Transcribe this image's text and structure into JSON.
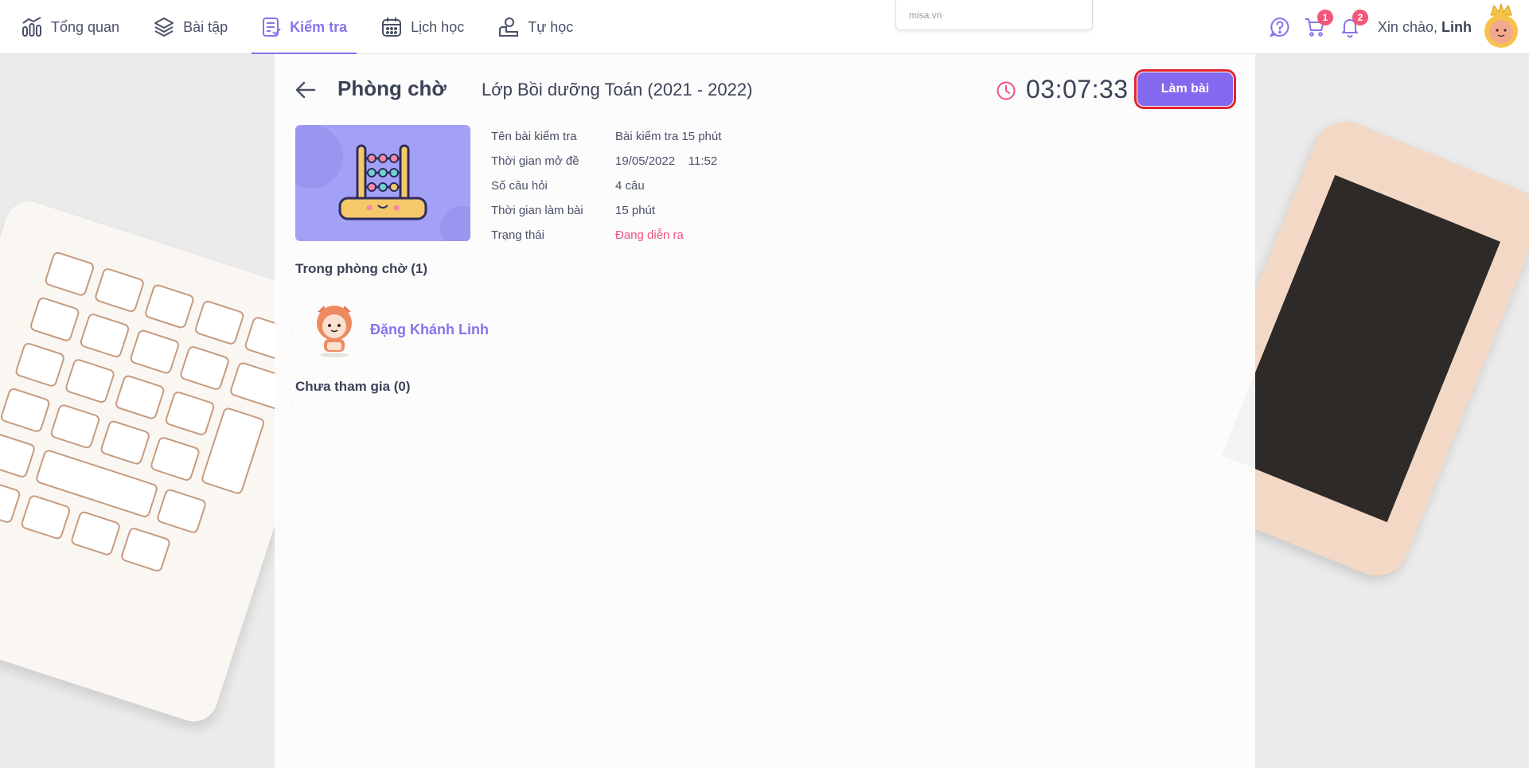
{
  "nav": {
    "items": [
      {
        "label": "Tổng quan",
        "icon": "chart-icon"
      },
      {
        "label": "Bài tập",
        "icon": "layers-icon"
      },
      {
        "label": "Kiểm tra",
        "icon": "test-icon",
        "active": true
      },
      {
        "label": "Lịch học",
        "icon": "calendar-icon"
      },
      {
        "label": "Tự học",
        "icon": "self-study-icon"
      }
    ]
  },
  "browser_hint": "misa.vn",
  "header_tools": {
    "cart_count": "1",
    "notification_count": "2",
    "greeting": "Xin chào,",
    "user_name": "Linh"
  },
  "room": {
    "title": "Phòng chờ",
    "class_name": "Lớp Bồi dưỡng Toán (2021 - 2022)",
    "timer": "03:07:33",
    "start_button": "Làm bài"
  },
  "exam_info": [
    {
      "label": "Tên bài kiểm tra",
      "value": "Bài kiểm tra 15 phút"
    },
    {
      "label": "Thời gian mở đề",
      "value": "19/05/2022    11:52"
    },
    {
      "label": "Số câu hỏi",
      "value": "4 câu"
    },
    {
      "label": "Thời gian làm bài",
      "value": "15 phút"
    },
    {
      "label": "Trạng thái",
      "value": "Đang diễn ra",
      "status": "live"
    }
  ],
  "waiting": {
    "title": "Trong phòng chờ (1)",
    "members": [
      {
        "name": "Đặng Khánh Linh"
      }
    ]
  },
  "not_joined": {
    "title": "Chưa tham gia (0)"
  },
  "colors": {
    "accent": "#8269ee",
    "status_live": "#f0507e",
    "badge": "#f2577a"
  }
}
